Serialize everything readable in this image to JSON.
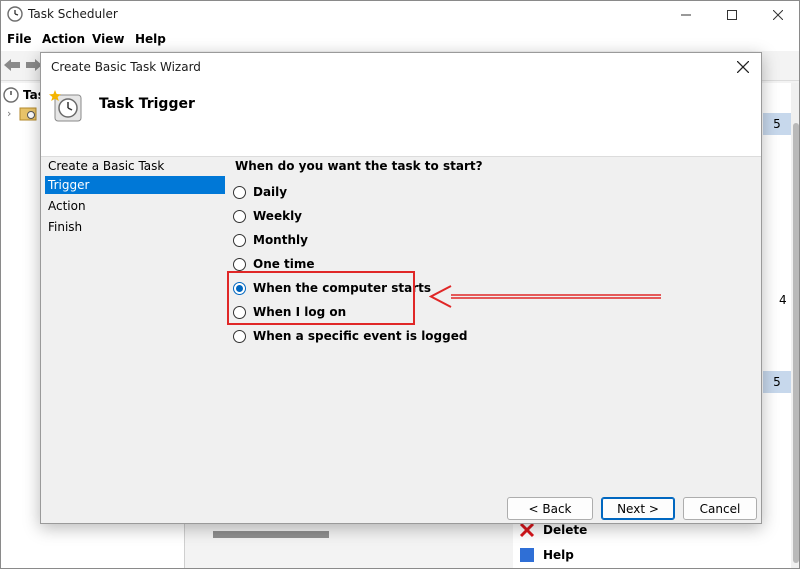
{
  "app": {
    "title": "Task Scheduler",
    "menu": [
      "File",
      "Action",
      "View",
      "Help"
    ],
    "tree_root_label": "Tas",
    "tree_expander": "›",
    "right_values": [
      "5",
      "4",
      "5"
    ],
    "actions": [
      "Delete",
      "Help"
    ]
  },
  "dialog": {
    "title": "Create Basic Task Wizard",
    "header_title": "Task Trigger",
    "steps": [
      "Create a Basic Task",
      "Trigger",
      "Action",
      "Finish"
    ],
    "active_step": "Trigger",
    "question": "When do you want the task to start?",
    "options": [
      "Daily",
      "Weekly",
      "Monthly",
      "One time",
      "When the computer starts",
      "When I log on",
      "When a specific event is logged"
    ],
    "selected_option": "When the computer starts",
    "buttons": {
      "back": "< Back",
      "next": "Next >",
      "cancel": "Cancel"
    }
  },
  "colors": {
    "accent": "#0078d7",
    "annotation": "#e02727"
  },
  "icons": {
    "app": "clock-icon",
    "header": "clock-star-icon",
    "close": "close-icon",
    "back": "arrow-left-icon",
    "forward": "arrow-right-icon",
    "delete": "red-x-icon"
  }
}
